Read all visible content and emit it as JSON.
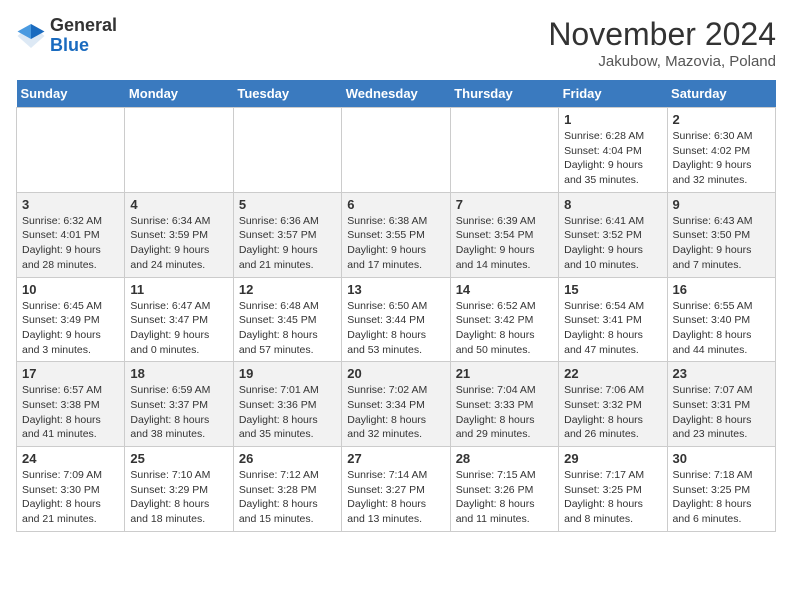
{
  "logo": {
    "general": "General",
    "blue": "Blue"
  },
  "title": "November 2024",
  "subtitle": "Jakubow, Mazovia, Poland",
  "days_of_week": [
    "Sunday",
    "Monday",
    "Tuesday",
    "Wednesday",
    "Thursday",
    "Friday",
    "Saturday"
  ],
  "weeks": [
    [
      {
        "day": "",
        "info": ""
      },
      {
        "day": "",
        "info": ""
      },
      {
        "day": "",
        "info": ""
      },
      {
        "day": "",
        "info": ""
      },
      {
        "day": "",
        "info": ""
      },
      {
        "day": "1",
        "info": "Sunrise: 6:28 AM\nSunset: 4:04 PM\nDaylight: 9 hours\nand 35 minutes."
      },
      {
        "day": "2",
        "info": "Sunrise: 6:30 AM\nSunset: 4:02 PM\nDaylight: 9 hours\nand 32 minutes."
      }
    ],
    [
      {
        "day": "3",
        "info": "Sunrise: 6:32 AM\nSunset: 4:01 PM\nDaylight: 9 hours\nand 28 minutes."
      },
      {
        "day": "4",
        "info": "Sunrise: 6:34 AM\nSunset: 3:59 PM\nDaylight: 9 hours\nand 24 minutes."
      },
      {
        "day": "5",
        "info": "Sunrise: 6:36 AM\nSunset: 3:57 PM\nDaylight: 9 hours\nand 21 minutes."
      },
      {
        "day": "6",
        "info": "Sunrise: 6:38 AM\nSunset: 3:55 PM\nDaylight: 9 hours\nand 17 minutes."
      },
      {
        "day": "7",
        "info": "Sunrise: 6:39 AM\nSunset: 3:54 PM\nDaylight: 9 hours\nand 14 minutes."
      },
      {
        "day": "8",
        "info": "Sunrise: 6:41 AM\nSunset: 3:52 PM\nDaylight: 9 hours\nand 10 minutes."
      },
      {
        "day": "9",
        "info": "Sunrise: 6:43 AM\nSunset: 3:50 PM\nDaylight: 9 hours\nand 7 minutes."
      }
    ],
    [
      {
        "day": "10",
        "info": "Sunrise: 6:45 AM\nSunset: 3:49 PM\nDaylight: 9 hours\nand 3 minutes."
      },
      {
        "day": "11",
        "info": "Sunrise: 6:47 AM\nSunset: 3:47 PM\nDaylight: 9 hours\nand 0 minutes."
      },
      {
        "day": "12",
        "info": "Sunrise: 6:48 AM\nSunset: 3:45 PM\nDaylight: 8 hours\nand 57 minutes."
      },
      {
        "day": "13",
        "info": "Sunrise: 6:50 AM\nSunset: 3:44 PM\nDaylight: 8 hours\nand 53 minutes."
      },
      {
        "day": "14",
        "info": "Sunrise: 6:52 AM\nSunset: 3:42 PM\nDaylight: 8 hours\nand 50 minutes."
      },
      {
        "day": "15",
        "info": "Sunrise: 6:54 AM\nSunset: 3:41 PM\nDaylight: 8 hours\nand 47 minutes."
      },
      {
        "day": "16",
        "info": "Sunrise: 6:55 AM\nSunset: 3:40 PM\nDaylight: 8 hours\nand 44 minutes."
      }
    ],
    [
      {
        "day": "17",
        "info": "Sunrise: 6:57 AM\nSunset: 3:38 PM\nDaylight: 8 hours\nand 41 minutes."
      },
      {
        "day": "18",
        "info": "Sunrise: 6:59 AM\nSunset: 3:37 PM\nDaylight: 8 hours\nand 38 minutes."
      },
      {
        "day": "19",
        "info": "Sunrise: 7:01 AM\nSunset: 3:36 PM\nDaylight: 8 hours\nand 35 minutes."
      },
      {
        "day": "20",
        "info": "Sunrise: 7:02 AM\nSunset: 3:34 PM\nDaylight: 8 hours\nand 32 minutes."
      },
      {
        "day": "21",
        "info": "Sunrise: 7:04 AM\nSunset: 3:33 PM\nDaylight: 8 hours\nand 29 minutes."
      },
      {
        "day": "22",
        "info": "Sunrise: 7:06 AM\nSunset: 3:32 PM\nDaylight: 8 hours\nand 26 minutes."
      },
      {
        "day": "23",
        "info": "Sunrise: 7:07 AM\nSunset: 3:31 PM\nDaylight: 8 hours\nand 23 minutes."
      }
    ],
    [
      {
        "day": "24",
        "info": "Sunrise: 7:09 AM\nSunset: 3:30 PM\nDaylight: 8 hours\nand 21 minutes."
      },
      {
        "day": "25",
        "info": "Sunrise: 7:10 AM\nSunset: 3:29 PM\nDaylight: 8 hours\nand 18 minutes."
      },
      {
        "day": "26",
        "info": "Sunrise: 7:12 AM\nSunset: 3:28 PM\nDaylight: 8 hours\nand 15 minutes."
      },
      {
        "day": "27",
        "info": "Sunrise: 7:14 AM\nSunset: 3:27 PM\nDaylight: 8 hours\nand 13 minutes."
      },
      {
        "day": "28",
        "info": "Sunrise: 7:15 AM\nSunset: 3:26 PM\nDaylight: 8 hours\nand 11 minutes."
      },
      {
        "day": "29",
        "info": "Sunrise: 7:17 AM\nSunset: 3:25 PM\nDaylight: 8 hours\nand 8 minutes."
      },
      {
        "day": "30",
        "info": "Sunrise: 7:18 AM\nSunset: 3:25 PM\nDaylight: 8 hours\nand 6 minutes."
      }
    ]
  ]
}
